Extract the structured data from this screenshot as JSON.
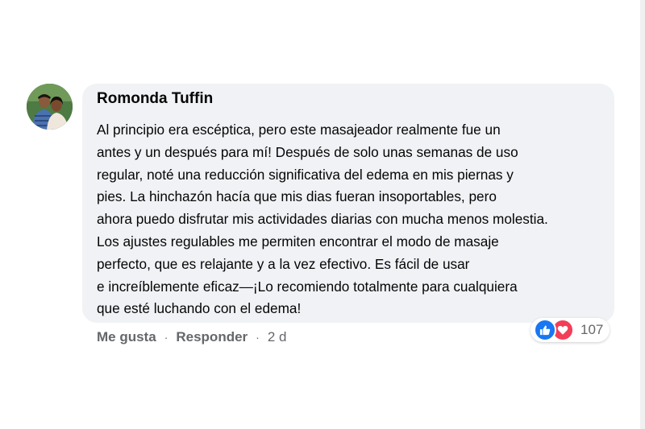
{
  "comment": {
    "author": "Romonda Tuffin",
    "lines": [
      "Al principio era escéptica, pero este masajeador realmente fue un",
      "antes y un después para mí! Después de solo unas semanas de uso",
      "regular, noté una reducción significativa del edema en mis piernas y",
      "pies. La hinchazón hacía que mis dias fueran insoportables, pero",
      "ahora puedo disfrutar mis actividades diarias con mucha menos molestia.",
      "Los ajustes regulables me permiten encontrar el modo de masaje",
      "perfecto, que es relajante y a la vez efectivo. Es fácil de usar",
      "e increíblemente eficaz—¡Lo recomiendo totalmente para cualquiera",
      "que esté luchando con el edema!"
    ]
  },
  "actions": {
    "like_label": "Me gusta",
    "separator": "·",
    "reply_label": "Responder",
    "time": "2 d"
  },
  "reactions": {
    "icons": [
      "thumbs-up-icon",
      "heart-icon"
    ],
    "count": "107",
    "like_color": "#1877f2",
    "love_color": "#f33e58"
  },
  "colors": {
    "bubble_bg": "#f0f2f5",
    "meta_text": "#65676b",
    "body_text": "#050505"
  }
}
